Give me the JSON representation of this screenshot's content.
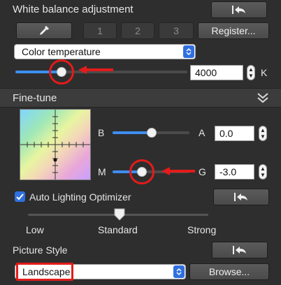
{
  "white_balance": {
    "title": "White balance adjustment",
    "undo_icon": "undo-arrow-icon",
    "eyedropper_icon": "eyedropper-icon",
    "slots": [
      "1",
      "2",
      "3"
    ],
    "register_label": "Register...",
    "mode_value": "Color temperature",
    "temperature_value": "4000",
    "temperature_unit": "K"
  },
  "fine_tune": {
    "title": "Fine-tune",
    "collapse_icon": "double-chevron-icon",
    "ba_left": "B",
    "ba_right": "A",
    "ba_value": "0.0",
    "mg_left": "M",
    "mg_right": "G",
    "mg_value": "-3.0"
  },
  "alo": {
    "checked": true,
    "label": "Auto Lighting Optimizer",
    "level_low": "Low",
    "level_standard": "Standard",
    "level_strong": "Strong",
    "selected": "Standard"
  },
  "picture_style": {
    "title": "Picture Style",
    "value": "Landscape",
    "browse_label": "Browse..."
  },
  "colors": {
    "accent": "#3d8ef0",
    "highlight": "#e41b1b",
    "panel": "#2e2e2e"
  }
}
